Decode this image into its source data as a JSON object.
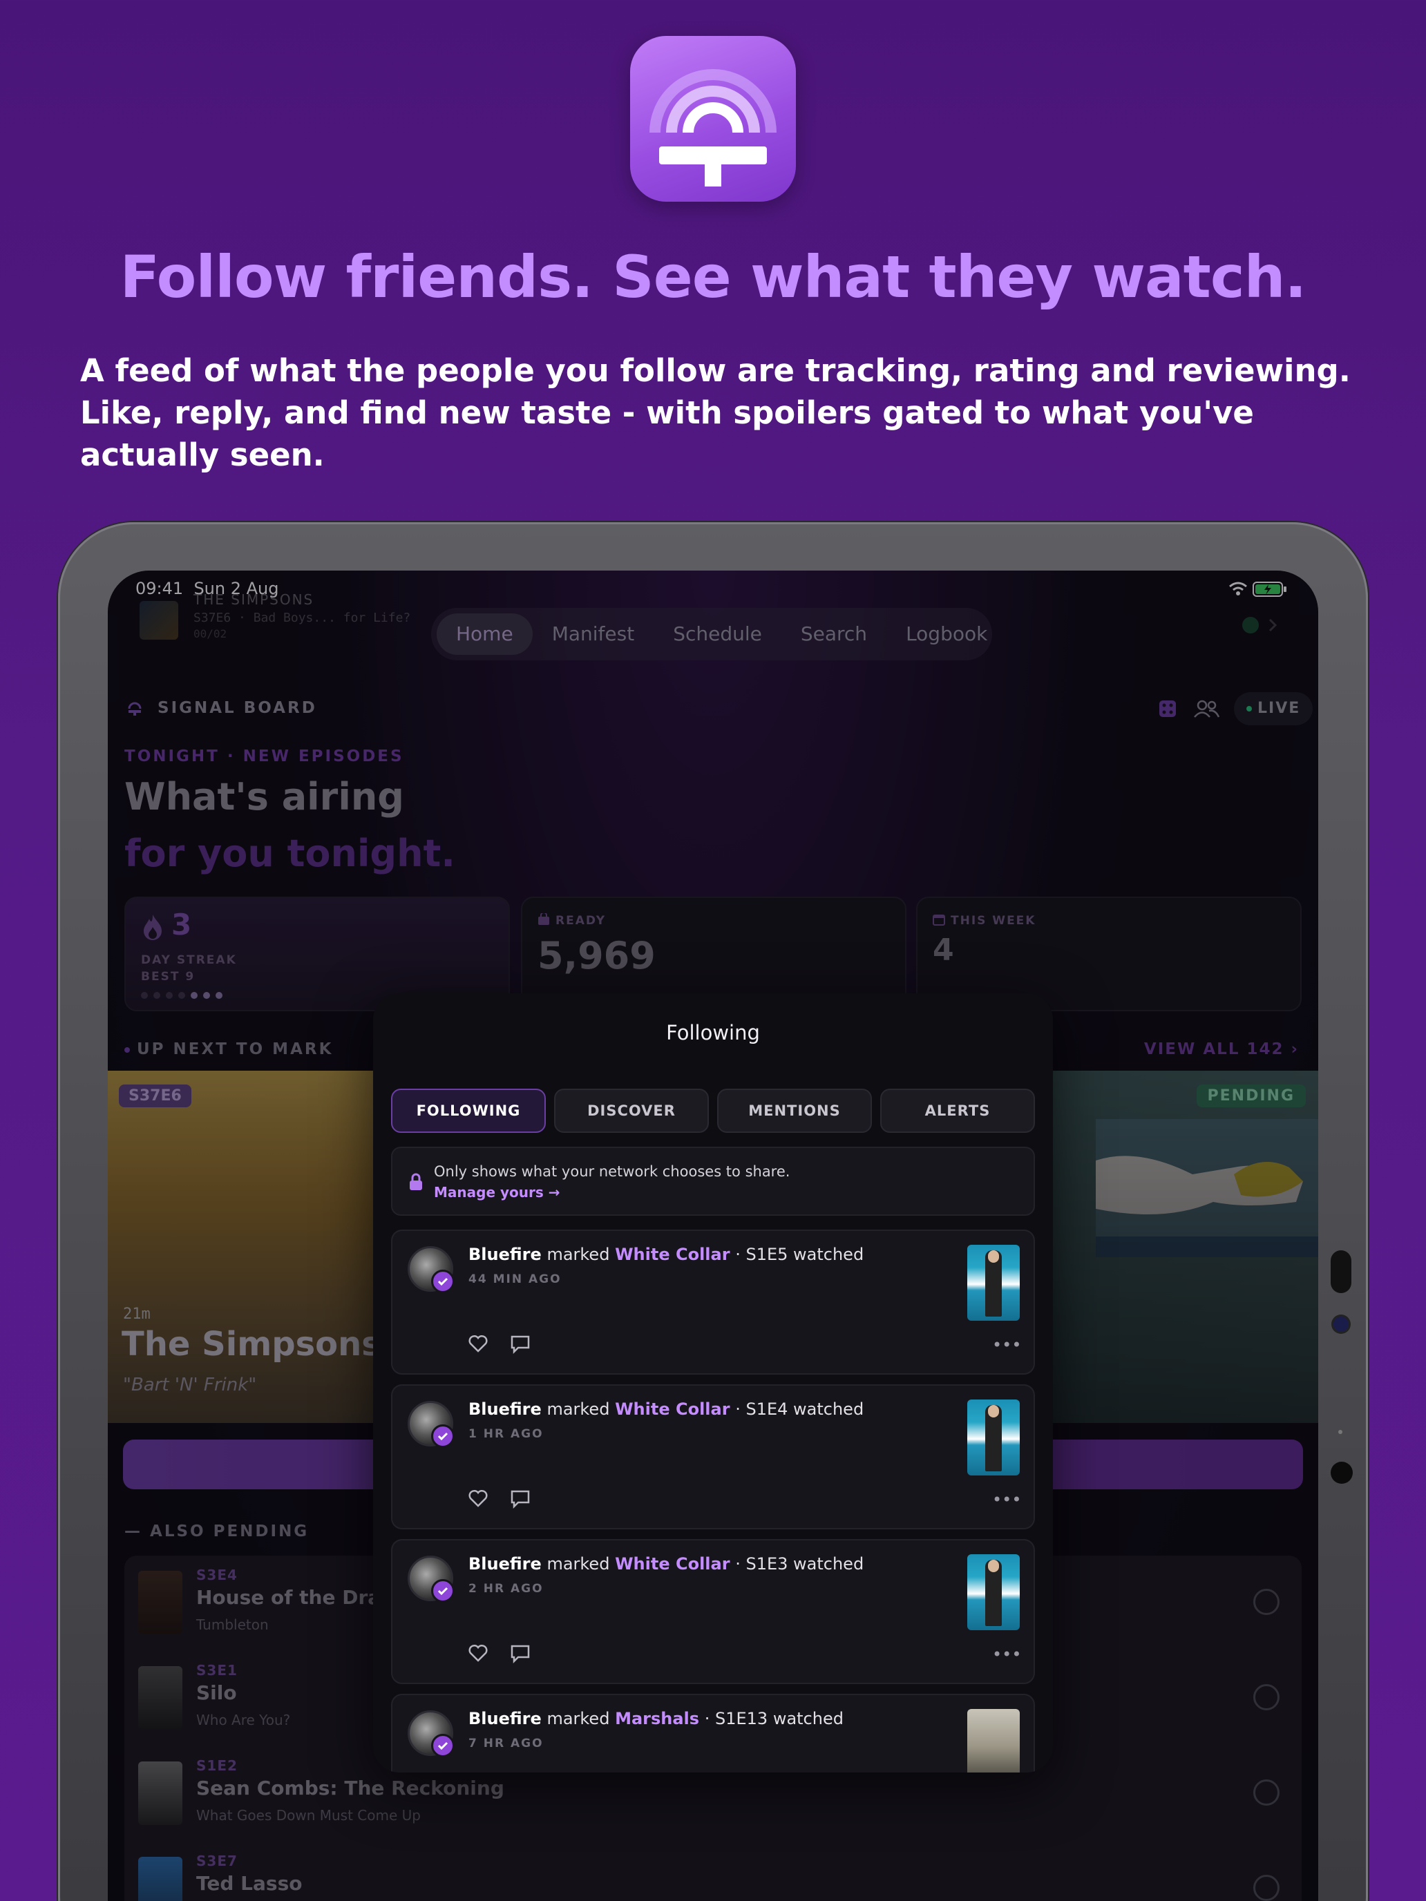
{
  "marketing": {
    "headline": "Follow friends. See what they watch.",
    "subhead": "A feed of what the people you follow are tracking, rating and reviewing. Like, reply, and find new taste - with spoilers gated to what you've actually seen.",
    "icon": "app-logo-icon"
  },
  "status_bar": {
    "time": "09:41",
    "date": "Sun 2 Aug"
  },
  "now_playing": {
    "title": "THE SIMPSONS",
    "subtitle": "S37E6 · Bad Boys... for Life?",
    "progress": "00/02"
  },
  "nav": {
    "tabs": [
      "Home",
      "Manifest",
      "Schedule",
      "Search",
      "Logbook"
    ],
    "active": "Home"
  },
  "board": {
    "title": "SIGNAL BOARD",
    "live_label": "LIVE",
    "kicker": "TONIGHT · NEW EPISODES",
    "heading_1": "What's airing",
    "heading_2": "for you tonight."
  },
  "stats": {
    "streak_value": "3",
    "streak_label": "DAY STREAK",
    "streak_best": "BEST 9",
    "ready_label": "READY",
    "ready_value": "5,969",
    "week_label": "THIS WEEK",
    "week_value": "4"
  },
  "up_next": {
    "label": "UP NEXT TO MARK",
    "view_all": "VIEW ALL 142",
    "episode_badge": "S37E6",
    "status_badge": "PENDING",
    "runtime": "21m",
    "title": "The Simpsons",
    "episode_title": "\"Bart 'N' Frink\""
  },
  "also_pending": {
    "label": "ALSO PENDING",
    "items": [
      {
        "ep": "S3E4",
        "title": "House of the Dragon",
        "sub": "Tumbleton"
      },
      {
        "ep": "S3E1",
        "title": "Silo",
        "sub": "Who Are You?"
      },
      {
        "ep": "S1E2",
        "title": "Sean Combs: The Reckoning",
        "sub": "What Goes Down Must Come Up"
      },
      {
        "ep": "S3E7",
        "title": "Ted Lasso",
        "sub": ""
      }
    ]
  },
  "following": {
    "title": "Following",
    "tabs": [
      "FOLLOWING",
      "DISCOVER",
      "MENTIONS",
      "ALERTS"
    ],
    "active_tab": "FOLLOWING",
    "privacy_text": "Only shows what your network chooses to share.",
    "privacy_link": "Manage yours →",
    "feed": [
      {
        "user": "Bluefire",
        "verb": "marked",
        "show": "White Collar",
        "rest": "· S1E5 watched",
        "time": "44 MIN AGO"
      },
      {
        "user": "Bluefire",
        "verb": "marked",
        "show": "White Collar",
        "rest": "· S1E4 watched",
        "time": "1 HR AGO"
      },
      {
        "user": "Bluefire",
        "verb": "marked",
        "show": "White Collar",
        "rest": "· S1E3 watched",
        "time": "2 HR AGO"
      },
      {
        "user": "Bluefire",
        "verb": "marked",
        "show": "Marshals",
        "rest": "· S1E13 watched",
        "time": "7 HR AGO"
      }
    ]
  },
  "colors": {
    "accent": "#c58cff",
    "background": "#541a86",
    "pending": "#2d6b4e"
  }
}
